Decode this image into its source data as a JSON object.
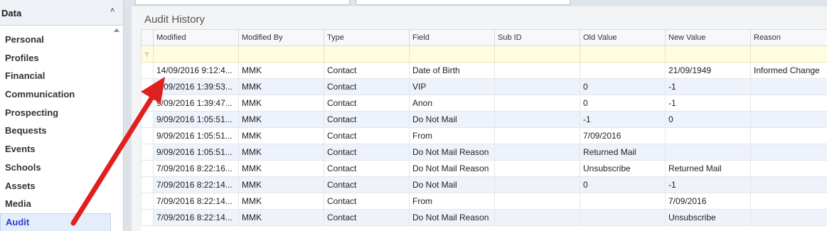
{
  "sidebar": {
    "title": "Data",
    "collapse_glyph": "˄",
    "items": [
      {
        "label": "Personal"
      },
      {
        "label": "Profiles"
      },
      {
        "label": "Financial"
      },
      {
        "label": "Communication"
      },
      {
        "label": "Prospecting"
      },
      {
        "label": "Bequests"
      },
      {
        "label": "Events"
      },
      {
        "label": "Schools"
      },
      {
        "label": "Assets"
      },
      {
        "label": "Media"
      },
      {
        "label": "Audit"
      }
    ],
    "active": "Audit"
  },
  "panel": {
    "title": "Audit History"
  },
  "grid": {
    "filter_icon": "⊤",
    "columns": [
      "Modified",
      "Modified By",
      "Type",
      "Field",
      "Sub ID",
      "Old Value",
      "New Value",
      "Reason"
    ],
    "rows": [
      [
        "14/09/2016 9:12:4...",
        "MMK",
        "Contact",
        "Date of Birth",
        "",
        "",
        "21/09/1949",
        "Informed Change"
      ],
      [
        "9/09/2016 1:39:53...",
        "MMK",
        "Contact",
        "VIP",
        "",
        "0",
        "-1",
        ""
      ],
      [
        "9/09/2016 1:39:47...",
        "MMK",
        "Contact",
        "Anon",
        "",
        "0",
        "-1",
        ""
      ],
      [
        "9/09/2016 1:05:51...",
        "MMK",
        "Contact",
        "Do Not Mail",
        "",
        "-1",
        "0",
        ""
      ],
      [
        "9/09/2016 1:05:51...",
        "MMK",
        "Contact",
        "From",
        "",
        "7/09/2016",
        "",
        ""
      ],
      [
        "9/09/2016 1:05:51...",
        "MMK",
        "Contact",
        "Do Not Mail Reason",
        "",
        "Returned Mail",
        "",
        ""
      ],
      [
        "7/09/2016 8:22:16...",
        "MMK",
        "Contact",
        "Do Not Mail Reason",
        "",
        "Unsubscribe",
        "Returned Mail",
        ""
      ],
      [
        "7/09/2016 8:22:14...",
        "MMK",
        "Contact",
        "Do Not Mail",
        "",
        "0",
        "-1",
        ""
      ],
      [
        "7/09/2016 8:22:14...",
        "MMK",
        "Contact",
        "From",
        "",
        "",
        "7/09/2016",
        ""
      ],
      [
        "7/09/2016 8:22:14...",
        "MMK",
        "Contact",
        "Do Not Mail Reason",
        "",
        "",
        "Unsubscribe",
        ""
      ]
    ]
  },
  "colors": {
    "accent": "#2a3dce",
    "filter_row": "#fffde0",
    "alt_row": "#eef2fb",
    "annotation_arrow": "#e0201e"
  }
}
